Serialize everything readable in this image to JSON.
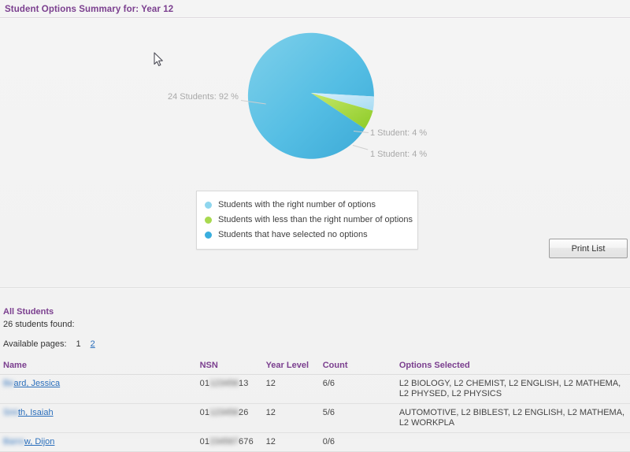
{
  "header": {
    "title": "Student Options Summary for: Year 12"
  },
  "chart_data": {
    "type": "pie",
    "title": "Student Options Summary for: Year 12",
    "categories": [
      "Students with the right number of options",
      "Students with less than the right number of options",
      "Students that have selected no options"
    ],
    "values": [
      24,
      1,
      1
    ],
    "percentages": [
      92,
      4,
      4
    ],
    "colors": [
      "#5cc0e5",
      "#a8d94f",
      "#bfe3f5"
    ],
    "data_labels": [
      "24 Students: 92 %",
      "1 Student: 4 %",
      "1 Student: 4 %"
    ],
    "legend_position": "bottom",
    "total": 26
  },
  "chart": {
    "labels": {
      "big": "24 Students: 92 %",
      "mid": "1 Student: 4 %",
      "small": "1 Student: 4 %"
    },
    "legend": [
      {
        "label": "Students with the right number of options",
        "color": "#8fd6ee"
      },
      {
        "label": "Students with less than the right number of options",
        "color": "#a8d94f"
      },
      {
        "label": "Students that have selected no options",
        "color": "#39aede"
      }
    ]
  },
  "toolbar": {
    "print_label": "Print List"
  },
  "students_section": {
    "heading": "All Students",
    "found_text": "26 students found:",
    "pages_label": "Available pages:",
    "current_page": "1",
    "next_page": "2"
  },
  "table": {
    "columns": [
      "Name",
      "NSN",
      "Year Level",
      "Count",
      "Options Selected"
    ],
    "rows": [
      {
        "name_hidden": "Be",
        "name_visible": "ard, Jessica",
        "nsn_prefix": "01",
        "nsn_hidden": "123456",
        "nsn_suffix": "13",
        "year_level": "12",
        "count": "6/6",
        "options": "L2 BIOLOGY, L2 CHEMIST, L2 ENGLISH, L2 MATHEMA, L2 PHYSED, L2 PHYSICS"
      },
      {
        "name_hidden": "Smi",
        "name_visible": "th, Isaiah",
        "nsn_prefix": "01",
        "nsn_hidden": "123456",
        "nsn_suffix": "26",
        "year_level": "12",
        "count": "5/6",
        "options": "AUTOMOTIVE, L2 BIBLEST, L2 ENGLISH, L2 MATHEMA, L2 WORKPLA"
      },
      {
        "name_hidden": "Barro",
        "name_visible": "w, Dijon",
        "nsn_prefix": "01",
        "nsn_hidden": "234567",
        "nsn_suffix": "676",
        "year_level": "12",
        "count": "0/6",
        "options": ""
      }
    ]
  }
}
